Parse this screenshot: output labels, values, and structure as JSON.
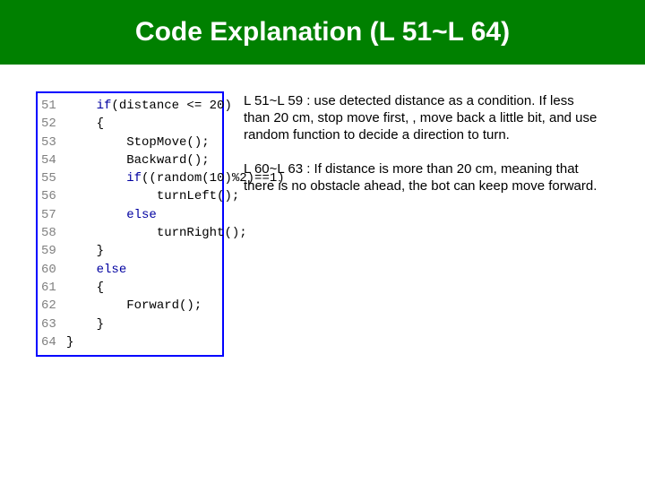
{
  "header": {
    "title": "Code Explanation (L 51~L 64)"
  },
  "code": {
    "lines": [
      {
        "num": "51",
        "indent": "    ",
        "pre": "",
        "kw": "if",
        "post": "(distance <= 20)"
      },
      {
        "num": "52",
        "indent": "    ",
        "pre": "{",
        "kw": "",
        "post": ""
      },
      {
        "num": "53",
        "indent": "        ",
        "pre": "StopMove();",
        "kw": "",
        "post": ""
      },
      {
        "num": "54",
        "indent": "        ",
        "pre": "Backward();",
        "kw": "",
        "post": ""
      },
      {
        "num": "55",
        "indent": "        ",
        "pre": "",
        "kw": "if",
        "post": "((random(10)%2)==1)"
      },
      {
        "num": "56",
        "indent": "            ",
        "pre": "turnLeft();",
        "kw": "",
        "post": ""
      },
      {
        "num": "57",
        "indent": "        ",
        "pre": "",
        "kw": "else",
        "post": ""
      },
      {
        "num": "58",
        "indent": "            ",
        "pre": "turnRight();",
        "kw": "",
        "post": ""
      },
      {
        "num": "59",
        "indent": "    ",
        "pre": "}",
        "kw": "",
        "post": ""
      },
      {
        "num": "60",
        "indent": "    ",
        "pre": "",
        "kw": "else",
        "post": ""
      },
      {
        "num": "61",
        "indent": "    ",
        "pre": "{",
        "kw": "",
        "post": ""
      },
      {
        "num": "62",
        "indent": "        ",
        "pre": "Forward();",
        "kw": "",
        "post": ""
      },
      {
        "num": "63",
        "indent": "    ",
        "pre": "}",
        "kw": "",
        "post": ""
      },
      {
        "num": "64",
        "indent": "",
        "pre": "}",
        "kw": "",
        "post": ""
      }
    ]
  },
  "notes": {
    "p1_lead": "L 51~L 59 : ",
    "p1_body": "use detected distance as a condition.  If less than 20 cm, stop move first, , move back a little bit, and use random function to decide a direction to turn.",
    "p2_lead": "L 60~L 63 : ",
    "p2_body": "If distance is more than 20 cm, meaning that there is no obstacle ahead, the bot can keep move forward."
  }
}
